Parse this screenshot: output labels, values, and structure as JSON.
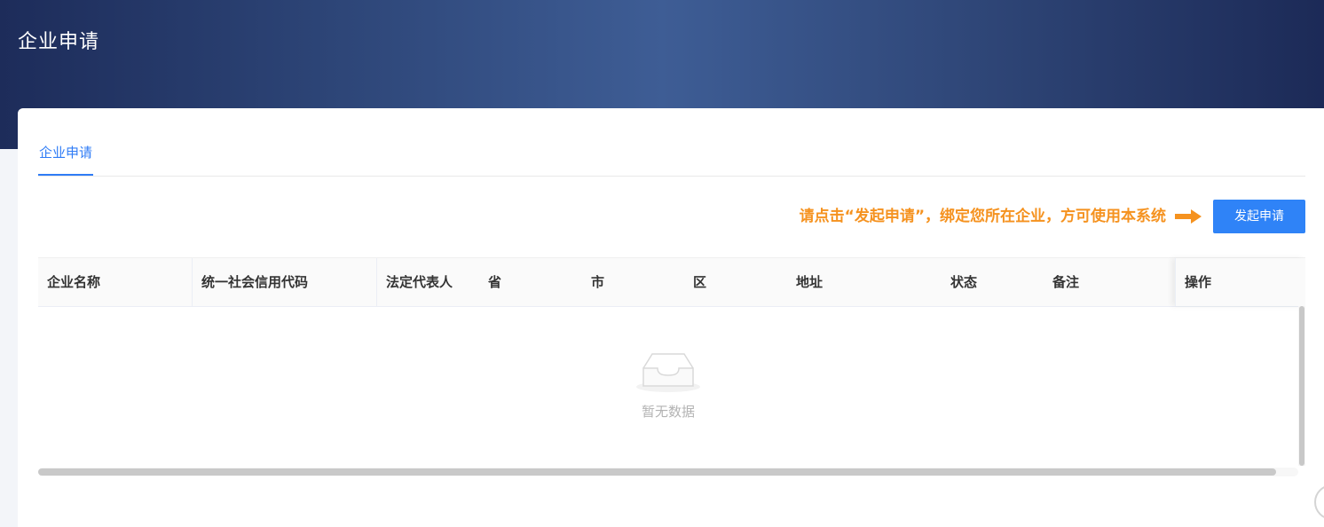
{
  "header": {
    "title": "企业申请"
  },
  "tabs": [
    {
      "label": "企业申请",
      "active": true
    }
  ],
  "notice": {
    "text": "请点击“发起申请”，绑定您所在企业，方可使用本系统",
    "color": "#f5921f",
    "icon": "arrow-right-icon"
  },
  "actions": {
    "apply_label": "发起申请"
  },
  "table": {
    "columns": [
      "企业名称",
      "统一社会信用代码",
      "法定代表人",
      "省",
      "市",
      "区",
      "地址",
      "状态",
      "备注"
    ],
    "fixed_column": "操作",
    "rows": [],
    "empty_text": "暂无数据",
    "empty_icon": "empty-inbox-icon"
  },
  "colors": {
    "accent": "#2f7cf6",
    "button": "#2f83f7",
    "header_gradient": [
      "#1d2c5a",
      "#3e5d95",
      "#1c2a57"
    ]
  }
}
